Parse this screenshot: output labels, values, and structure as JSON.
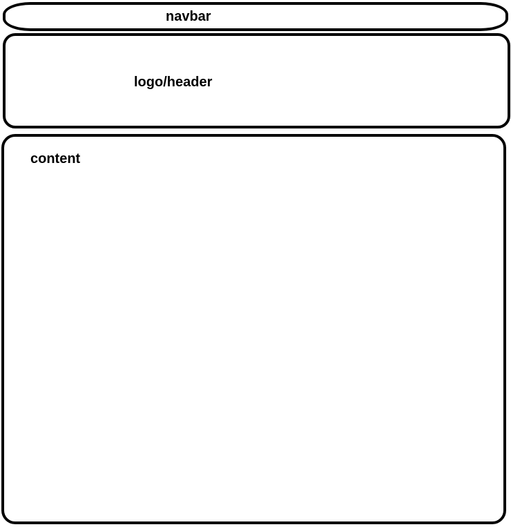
{
  "navbar": {
    "label": "navbar"
  },
  "header": {
    "label": "logo/header"
  },
  "content": {
    "label": "content"
  }
}
